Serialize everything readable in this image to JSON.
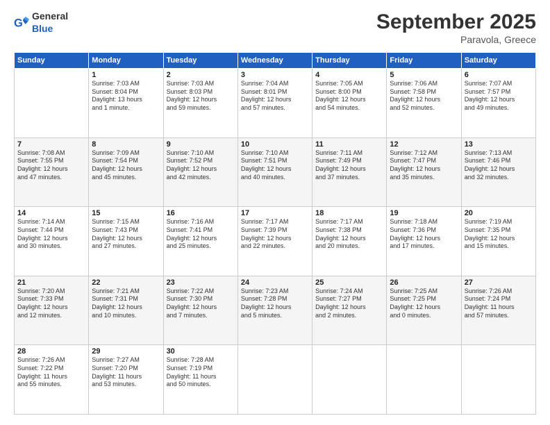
{
  "header": {
    "logo_general": "General",
    "logo_blue": "Blue",
    "month_title": "September 2025",
    "location": "Paravola, Greece"
  },
  "days_of_week": [
    "Sunday",
    "Monday",
    "Tuesday",
    "Wednesday",
    "Thursday",
    "Friday",
    "Saturday"
  ],
  "weeks": [
    [
      {
        "day": "",
        "info": ""
      },
      {
        "day": "1",
        "info": "Sunrise: 7:03 AM\nSunset: 8:04 PM\nDaylight: 13 hours\nand 1 minute."
      },
      {
        "day": "2",
        "info": "Sunrise: 7:03 AM\nSunset: 8:03 PM\nDaylight: 12 hours\nand 59 minutes."
      },
      {
        "day": "3",
        "info": "Sunrise: 7:04 AM\nSunset: 8:01 PM\nDaylight: 12 hours\nand 57 minutes."
      },
      {
        "day": "4",
        "info": "Sunrise: 7:05 AM\nSunset: 8:00 PM\nDaylight: 12 hours\nand 54 minutes."
      },
      {
        "day": "5",
        "info": "Sunrise: 7:06 AM\nSunset: 7:58 PM\nDaylight: 12 hours\nand 52 minutes."
      },
      {
        "day": "6",
        "info": "Sunrise: 7:07 AM\nSunset: 7:57 PM\nDaylight: 12 hours\nand 49 minutes."
      }
    ],
    [
      {
        "day": "7",
        "info": "Sunrise: 7:08 AM\nSunset: 7:55 PM\nDaylight: 12 hours\nand 47 minutes."
      },
      {
        "day": "8",
        "info": "Sunrise: 7:09 AM\nSunset: 7:54 PM\nDaylight: 12 hours\nand 45 minutes."
      },
      {
        "day": "9",
        "info": "Sunrise: 7:10 AM\nSunset: 7:52 PM\nDaylight: 12 hours\nand 42 minutes."
      },
      {
        "day": "10",
        "info": "Sunrise: 7:10 AM\nSunset: 7:51 PM\nDaylight: 12 hours\nand 40 minutes."
      },
      {
        "day": "11",
        "info": "Sunrise: 7:11 AM\nSunset: 7:49 PM\nDaylight: 12 hours\nand 37 minutes."
      },
      {
        "day": "12",
        "info": "Sunrise: 7:12 AM\nSunset: 7:47 PM\nDaylight: 12 hours\nand 35 minutes."
      },
      {
        "day": "13",
        "info": "Sunrise: 7:13 AM\nSunset: 7:46 PM\nDaylight: 12 hours\nand 32 minutes."
      }
    ],
    [
      {
        "day": "14",
        "info": "Sunrise: 7:14 AM\nSunset: 7:44 PM\nDaylight: 12 hours\nand 30 minutes."
      },
      {
        "day": "15",
        "info": "Sunrise: 7:15 AM\nSunset: 7:43 PM\nDaylight: 12 hours\nand 27 minutes."
      },
      {
        "day": "16",
        "info": "Sunrise: 7:16 AM\nSunset: 7:41 PM\nDaylight: 12 hours\nand 25 minutes."
      },
      {
        "day": "17",
        "info": "Sunrise: 7:17 AM\nSunset: 7:39 PM\nDaylight: 12 hours\nand 22 minutes."
      },
      {
        "day": "18",
        "info": "Sunrise: 7:17 AM\nSunset: 7:38 PM\nDaylight: 12 hours\nand 20 minutes."
      },
      {
        "day": "19",
        "info": "Sunrise: 7:18 AM\nSunset: 7:36 PM\nDaylight: 12 hours\nand 17 minutes."
      },
      {
        "day": "20",
        "info": "Sunrise: 7:19 AM\nSunset: 7:35 PM\nDaylight: 12 hours\nand 15 minutes."
      }
    ],
    [
      {
        "day": "21",
        "info": "Sunrise: 7:20 AM\nSunset: 7:33 PM\nDaylight: 12 hours\nand 12 minutes."
      },
      {
        "day": "22",
        "info": "Sunrise: 7:21 AM\nSunset: 7:31 PM\nDaylight: 12 hours\nand 10 minutes."
      },
      {
        "day": "23",
        "info": "Sunrise: 7:22 AM\nSunset: 7:30 PM\nDaylight: 12 hours\nand 7 minutes."
      },
      {
        "day": "24",
        "info": "Sunrise: 7:23 AM\nSunset: 7:28 PM\nDaylight: 12 hours\nand 5 minutes."
      },
      {
        "day": "25",
        "info": "Sunrise: 7:24 AM\nSunset: 7:27 PM\nDaylight: 12 hours\nand 2 minutes."
      },
      {
        "day": "26",
        "info": "Sunrise: 7:25 AM\nSunset: 7:25 PM\nDaylight: 12 hours\nand 0 minutes."
      },
      {
        "day": "27",
        "info": "Sunrise: 7:26 AM\nSunset: 7:24 PM\nDaylight: 11 hours\nand 57 minutes."
      }
    ],
    [
      {
        "day": "28",
        "info": "Sunrise: 7:26 AM\nSunset: 7:22 PM\nDaylight: 11 hours\nand 55 minutes."
      },
      {
        "day": "29",
        "info": "Sunrise: 7:27 AM\nSunset: 7:20 PM\nDaylight: 11 hours\nand 53 minutes."
      },
      {
        "day": "30",
        "info": "Sunrise: 7:28 AM\nSunset: 7:19 PM\nDaylight: 11 hours\nand 50 minutes."
      },
      {
        "day": "",
        "info": ""
      },
      {
        "day": "",
        "info": ""
      },
      {
        "day": "",
        "info": ""
      },
      {
        "day": "",
        "info": ""
      }
    ]
  ]
}
